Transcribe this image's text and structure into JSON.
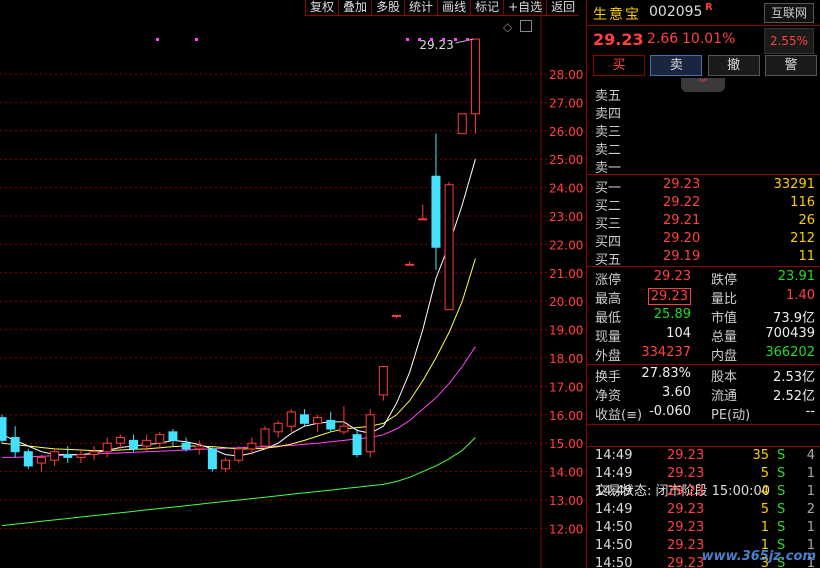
{
  "toolbar": {
    "items": [
      "复权",
      "叠加",
      "多股",
      "统计",
      "画线",
      "标记",
      "+自选",
      "返回"
    ]
  },
  "stock": {
    "name": "生意宝",
    "code": "002095",
    "badge": "R",
    "exchange_btn": "互联网",
    "price": "29.23",
    "change": "2.66",
    "change_pct": "10.01%",
    "sector_pct": "2.55%"
  },
  "actions": {
    "buy": "买",
    "sell": "卖",
    "cancel": "撤",
    "alert": "警",
    "collapse": "︾"
  },
  "sell_book": [
    {
      "label": "卖五",
      "price": "",
      "vol": ""
    },
    {
      "label": "卖四",
      "price": "",
      "vol": ""
    },
    {
      "label": "卖三",
      "price": "",
      "vol": ""
    },
    {
      "label": "卖二",
      "price": "",
      "vol": ""
    },
    {
      "label": "卖一",
      "price": "",
      "vol": ""
    }
  ],
  "buy_book": [
    {
      "label": "买一",
      "price": "29.23",
      "vol": "33291"
    },
    {
      "label": "买二",
      "price": "29.22",
      "vol": "116"
    },
    {
      "label": "买三",
      "price": "29.21",
      "vol": "26"
    },
    {
      "label": "买四",
      "price": "29.20",
      "vol": "212"
    },
    {
      "label": "买五",
      "price": "29.19",
      "vol": "11"
    }
  ],
  "quote": [
    {
      "l1": "涨停",
      "v1": "29.23",
      "c1": "red",
      "l2": "跌停",
      "v2": "23.91",
      "c2": "green"
    },
    {
      "l1": "最高",
      "v1": "29.23",
      "c1": "red boxed",
      "l2": "量比",
      "v2": "1.40",
      "c2": "red"
    },
    {
      "l1": "最低",
      "v1": "25.89",
      "c1": "green",
      "l2": "市值",
      "v2": "73.9亿",
      "c2": "white"
    },
    {
      "l1": "现量",
      "v1": "104",
      "c1": "white",
      "l2": "总量",
      "v2": "700439",
      "c2": "white"
    },
    {
      "l1": "外盘",
      "v1": "334237",
      "c1": "red",
      "l2": "内盘",
      "v2": "366202",
      "c2": "green"
    }
  ],
  "fundamentals": [
    {
      "l1": "换手",
      "v1": "27.83%",
      "c1": "white",
      "l2": "股本",
      "v2": "2.53亿",
      "c2": "white"
    },
    {
      "l1": "净资",
      "v1": "3.60",
      "c1": "white",
      "l2": "流通",
      "v2": "2.52亿",
      "c2": "white"
    },
    {
      "l1": "收益(≡)",
      "v1": "-0.060",
      "c1": "white",
      "l2": "PE(动)",
      "v2": "--",
      "c2": "white"
    }
  ],
  "trade_status": "交易状态: 闭市阶段 15:00:00",
  "ticks": [
    {
      "time": "14:49",
      "price": "29.23",
      "vol": "35",
      "dir": "S",
      "n": "4"
    },
    {
      "time": "14:49",
      "price": "29.23",
      "vol": "5",
      "dir": "S",
      "n": "1"
    },
    {
      "time": "14:49",
      "price": "29.23",
      "vol": "4",
      "dir": "S",
      "n": "1"
    },
    {
      "time": "14:49",
      "price": "29.23",
      "vol": "5",
      "dir": "S",
      "n": "2"
    },
    {
      "time": "14:50",
      "price": "29.23",
      "vol": "1",
      "dir": "S",
      "n": "1"
    },
    {
      "time": "14:50",
      "price": "29.23",
      "vol": "1",
      "dir": "S",
      "n": "1"
    },
    {
      "time": "14:50",
      "price": "29.23",
      "vol": "3",
      "dir": "S",
      "n": "1"
    }
  ],
  "watermark": "www.365jz.com",
  "chart_data": {
    "type": "candlestick",
    "last_price_label": "29.23",
    "y_ticks": [
      "28.00",
      "27.00",
      "26.00",
      "25.00",
      "24.00",
      "23.00",
      "22.00",
      "21.00",
      "20.00",
      "19.00",
      "18.00",
      "17.00",
      "16.00",
      "15.00",
      "14.00",
      "13.00",
      "12.00"
    ],
    "ylim": [
      11.5,
      30
    ],
    "colors": {
      "up": "#ff3b3b",
      "down": "#44e0ff",
      "ma5": "#ffffff",
      "ma10": "#ffff44",
      "ma20": "#ff44ff",
      "ma60": "#44ff44"
    },
    "candles": [
      {
        "o": 15.9,
        "h": 16.0,
        "l": 15.0,
        "c": 15.1
      },
      {
        "o": 15.2,
        "h": 15.6,
        "l": 14.5,
        "c": 14.7
      },
      {
        "o": 14.7,
        "h": 14.8,
        "l": 14.1,
        "c": 14.2
      },
      {
        "o": 14.3,
        "h": 14.6,
        "l": 14.0,
        "c": 14.5
      },
      {
        "o": 14.4,
        "h": 14.8,
        "l": 14.2,
        "c": 14.7
      },
      {
        "o": 14.6,
        "h": 14.9,
        "l": 14.3,
        "c": 14.5
      },
      {
        "o": 14.5,
        "h": 14.8,
        "l": 14.3,
        "c": 14.6
      },
      {
        "o": 14.6,
        "h": 14.9,
        "l": 14.4,
        "c": 14.7
      },
      {
        "o": 14.7,
        "h": 15.2,
        "l": 14.5,
        "c": 15.0
      },
      {
        "o": 15.0,
        "h": 15.3,
        "l": 14.8,
        "c": 15.2
      },
      {
        "o": 15.1,
        "h": 15.3,
        "l": 14.7,
        "c": 14.8
      },
      {
        "o": 14.9,
        "h": 15.3,
        "l": 14.7,
        "c": 15.1
      },
      {
        "o": 15.0,
        "h": 15.4,
        "l": 14.8,
        "c": 15.3
      },
      {
        "o": 15.4,
        "h": 15.5,
        "l": 14.9,
        "c": 15.1
      },
      {
        "o": 15.0,
        "h": 15.2,
        "l": 14.7,
        "c": 14.8
      },
      {
        "o": 14.8,
        "h": 15.1,
        "l": 14.6,
        "c": 14.9
      },
      {
        "o": 14.8,
        "h": 14.9,
        "l": 14.0,
        "c": 14.1
      },
      {
        "o": 14.1,
        "h": 14.5,
        "l": 14.0,
        "c": 14.4
      },
      {
        "o": 14.4,
        "h": 14.9,
        "l": 14.3,
        "c": 14.8
      },
      {
        "o": 14.8,
        "h": 15.2,
        "l": 14.6,
        "c": 15.0
      },
      {
        "o": 14.9,
        "h": 15.6,
        "l": 14.8,
        "c": 15.5
      },
      {
        "o": 15.4,
        "h": 15.8,
        "l": 15.2,
        "c": 15.7
      },
      {
        "o": 15.6,
        "h": 16.2,
        "l": 15.4,
        "c": 16.1
      },
      {
        "o": 16.0,
        "h": 16.2,
        "l": 15.6,
        "c": 15.7
      },
      {
        "o": 15.7,
        "h": 16.0,
        "l": 15.4,
        "c": 15.9
      },
      {
        "o": 15.8,
        "h": 16.1,
        "l": 15.4,
        "c": 15.5
      },
      {
        "o": 15.4,
        "h": 16.3,
        "l": 15.3,
        "c": 15.6
      },
      {
        "o": 15.3,
        "h": 15.5,
        "l": 14.5,
        "c": 14.6
      },
      {
        "o": 14.7,
        "h": 16.2,
        "l": 14.5,
        "c": 16.0
      },
      {
        "o": 16.7,
        "h": 17.7,
        "l": 16.5,
        "c": 17.7
      },
      {
        "o": 19.5,
        "h": 19.5,
        "l": 19.4,
        "c": 19.5
      },
      {
        "o": 21.3,
        "h": 21.4,
        "l": 21.3,
        "c": 21.3
      },
      {
        "o": 22.9,
        "h": 23.4,
        "l": 22.9,
        "c": 22.9
      },
      {
        "o": 24.4,
        "h": 25.9,
        "l": 21.1,
        "c": 21.9
      },
      {
        "o": 19.7,
        "h": 24.2,
        "l": 19.7,
        "c": 24.1
      },
      {
        "o": 25.9,
        "h": 26.6,
        "l": 25.9,
        "c": 26.6
      },
      {
        "o": 26.6,
        "h": 29.23,
        "l": 25.89,
        "c": 29.23
      }
    ],
    "ma5": [
      15.3,
      15.1,
      14.9,
      14.7,
      14.6,
      14.6,
      14.6,
      14.65,
      14.75,
      14.85,
      14.9,
      14.95,
      15.0,
      15.1,
      15.05,
      14.95,
      14.8,
      14.6,
      14.55,
      14.65,
      14.8,
      15.0,
      15.35,
      15.6,
      15.7,
      15.75,
      15.75,
      15.45,
      15.35,
      15.6,
      16.4,
      17.5,
      19.0,
      20.8,
      22.0,
      23.4,
      25.0
    ],
    "ma10": [
      15.0,
      14.95,
      14.9,
      14.85,
      14.8,
      14.78,
      14.76,
      14.74,
      14.74,
      14.76,
      14.78,
      14.8,
      14.84,
      14.88,
      14.9,
      14.9,
      14.88,
      14.84,
      14.8,
      14.8,
      14.82,
      14.88,
      14.97,
      15.1,
      15.25,
      15.4,
      15.5,
      15.55,
      15.6,
      15.7,
      16.0,
      16.5,
      17.2,
      18.0,
      18.9,
      20.0,
      21.5
    ],
    "ma20": [
      14.5,
      14.5,
      14.52,
      14.54,
      14.56,
      14.58,
      14.6,
      14.62,
      14.64,
      14.66,
      14.68,
      14.7,
      14.72,
      14.74,
      14.76,
      14.78,
      14.8,
      14.82,
      14.84,
      14.86,
      14.88,
      14.9,
      14.92,
      14.96,
      15.0,
      15.05,
      15.1,
      15.15,
      15.2,
      15.3,
      15.5,
      15.8,
      16.2,
      16.6,
      17.1,
      17.7,
      18.4
    ],
    "ma60": [
      12.1,
      12.15,
      12.2,
      12.25,
      12.3,
      12.35,
      12.4,
      12.45,
      12.5,
      12.55,
      12.6,
      12.65,
      12.7,
      12.75,
      12.8,
      12.85,
      12.9,
      12.95,
      13.0,
      13.05,
      13.1,
      13.15,
      13.2,
      13.25,
      13.3,
      13.35,
      13.4,
      13.45,
      13.5,
      13.55,
      13.65,
      13.8,
      14.0,
      14.2,
      14.45,
      14.75,
      15.2
    ]
  }
}
